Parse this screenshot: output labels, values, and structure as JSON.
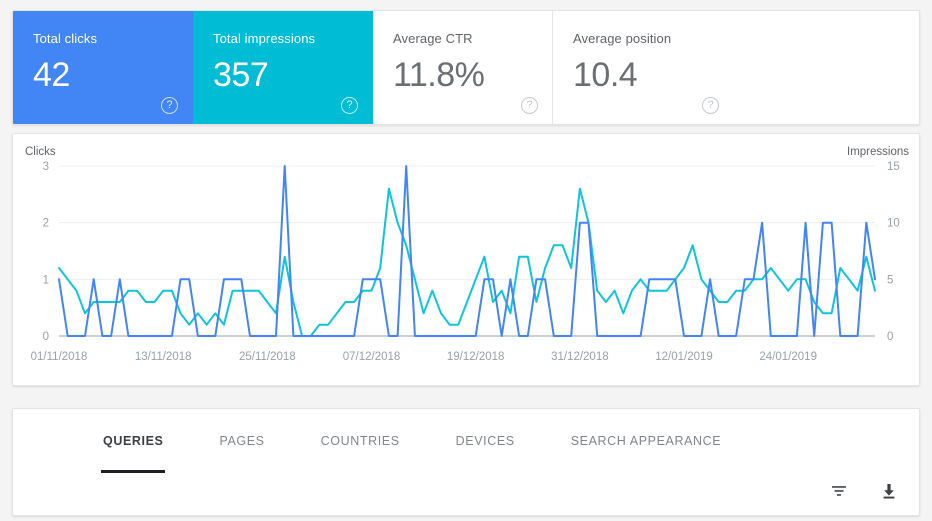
{
  "metrics": [
    {
      "label": "Total clicks",
      "value": "42",
      "state": "selected-blue",
      "help": "help-icon"
    },
    {
      "label": "Total impressions",
      "value": "357",
      "state": "selected-teal",
      "help": "help-icon"
    },
    {
      "label": "Average CTR",
      "value": "11.8%",
      "state": "",
      "help": "help-icon"
    },
    {
      "label": "Average position",
      "value": "10.4",
      "state": "",
      "help": "help-icon"
    }
  ],
  "chart_data": {
    "type": "line",
    "title": "",
    "xlabel": "",
    "ylabel": "Clicks",
    "y2label": "Impressions",
    "grid": true,
    "legend": "none",
    "left_axis": {
      "label": "Clicks",
      "ticks": [
        0,
        1,
        2,
        3
      ],
      "ylim": [
        0,
        3
      ]
    },
    "right_axis": {
      "label": "Impressions",
      "ticks": [
        0,
        5,
        10,
        15
      ],
      "ylim": [
        0,
        15
      ]
    },
    "x_tick_labels": [
      "01/11/2018",
      "13/11/2018",
      "25/11/2018",
      "07/12/2018",
      "19/12/2018",
      "31/12/2018",
      "12/01/2019",
      "24/01/2019"
    ],
    "x_tick_indices": [
      0,
      12,
      24,
      36,
      48,
      60,
      72,
      84
    ],
    "x_start": "01/11/2018",
    "x_end": "03/02/2019",
    "n_points": 95,
    "series": [
      {
        "name": "Clicks",
        "color": "#4285f4",
        "axis": "left",
        "values": [
          1,
          0,
          0,
          0,
          1,
          0,
          0,
          1,
          0,
          0,
          0,
          0,
          0,
          0,
          1,
          1,
          0,
          0,
          0,
          1,
          1,
          1,
          0,
          0,
          0,
          0,
          3,
          0,
          0,
          0,
          0,
          0,
          0,
          0,
          0,
          1,
          1,
          1,
          0,
          0,
          3,
          0,
          0,
          0,
          0,
          0,
          0,
          0,
          0,
          1,
          1,
          0,
          1,
          0,
          0,
          1,
          1,
          0,
          0,
          0,
          2,
          2,
          0,
          0,
          0,
          0,
          0,
          0,
          1,
          1,
          1,
          1,
          0,
          0,
          0,
          1,
          0,
          0,
          0,
          1,
          1,
          2,
          0,
          0,
          0,
          0,
          2,
          0,
          2,
          2,
          0,
          0,
          0,
          2,
          1
        ]
      },
      {
        "name": "Impressions",
        "color": "#0ec4dd",
        "axis": "right",
        "values": [
          6,
          5,
          4,
          2,
          3,
          3,
          3,
          3,
          4,
          4,
          3,
          3,
          4,
          4,
          2,
          1,
          2,
          1,
          2,
          1,
          4,
          4,
          4,
          4,
          3,
          2,
          7,
          3,
          0,
          0,
          1,
          1,
          2,
          3,
          3,
          4,
          4,
          6,
          13,
          10,
          8,
          5,
          2,
          4,
          2,
          1,
          1,
          3,
          5,
          7,
          3,
          4,
          2,
          7,
          7,
          3,
          6,
          8,
          8,
          6,
          13,
          10,
          4,
          3,
          4,
          2,
          4,
          5,
          4,
          4,
          4,
          5,
          6,
          8,
          5,
          4,
          3,
          3,
          4,
          4,
          5,
          5,
          6,
          5,
          4,
          5,
          5,
          3,
          2,
          2,
          6,
          5,
          4,
          7,
          4
        ]
      }
    ]
  },
  "table": {
    "tabs": [
      {
        "id": "queries",
        "label": "QUERIES",
        "active": true
      },
      {
        "id": "pages",
        "label": "PAGES",
        "active": false
      },
      {
        "id": "countries",
        "label": "COUNTRIES",
        "active": false
      },
      {
        "id": "devices",
        "label": "DEVICES",
        "active": false
      },
      {
        "id": "search-appearance",
        "label": "SEARCH APPEARANCE",
        "active": false
      }
    ],
    "toolbar": [
      {
        "id": "filter",
        "icon": "filter-icon"
      },
      {
        "id": "download",
        "icon": "download-icon"
      }
    ]
  },
  "colors": {
    "clicks": "#4285f4",
    "impressions": "#00bcd4",
    "page_background": "#f4f4f4",
    "card_background": "#ffffff",
    "tab_active_underline": "#202124",
    "axis_text": "#9aa0a6"
  }
}
